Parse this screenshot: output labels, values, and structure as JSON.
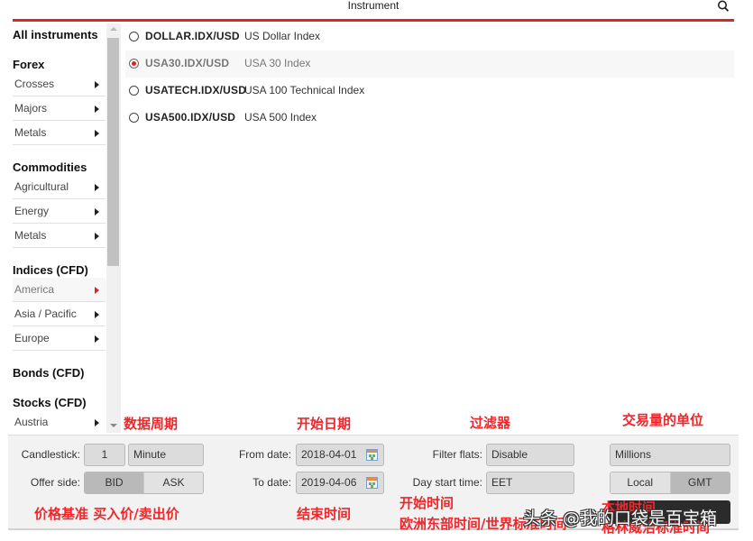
{
  "header": {
    "title": "Instrument",
    "search_icon": "magnifier",
    "accent_color": "#d9262c"
  },
  "sidebar": {
    "all_label": "All instruments",
    "groups": [
      {
        "heading": "Forex",
        "items": [
          "Crosses",
          "Majors",
          "Metals"
        ]
      },
      {
        "heading": "Commodities",
        "items": [
          "Agricultural",
          "Energy",
          "Metals"
        ]
      },
      {
        "heading": "Indices (CFD)",
        "items": [
          "America",
          "Asia / Pacific",
          "Europe"
        ],
        "selected": "America"
      },
      {
        "heading": "Bonds (CFD)",
        "items": []
      },
      {
        "heading": "Stocks (CFD)",
        "items": [
          "Austria"
        ]
      }
    ]
  },
  "instruments": [
    {
      "code": "DOLLAR.IDX/USD",
      "name": "US Dollar Index",
      "selected": false
    },
    {
      "code": "USA30.IDX/USD",
      "name": "USA 30 Index",
      "selected": true
    },
    {
      "code": "USATECH.IDX/USD",
      "name": "USA 100 Technical Index",
      "selected": false
    },
    {
      "code": "USA500.IDX/USD",
      "name": "USA 500 Index",
      "selected": false
    }
  ],
  "settings": {
    "candlestick_label": "Candlestick:",
    "candlestick_count": "1",
    "candlestick_unit": "Minute",
    "offer_side_label": "Offer side:",
    "offer_side_options": [
      "BID",
      "ASK"
    ],
    "offer_side_selected": "BID",
    "from_date_label": "From date:",
    "from_date": "2018-04-01",
    "to_date_label": "To date:",
    "to_date": "2019-04-06",
    "filter_flats_label": "Filter flats:",
    "filter_flats": "Disable",
    "day_start_label": "Day start time:",
    "day_start": "EET",
    "volume_unit": "Millions",
    "timezone_options": [
      "Local",
      "GMT"
    ],
    "timezone_selected": "GMT"
  },
  "annotations": {
    "period": "数据周期",
    "start_date": "开始日期",
    "filter": "过滤器",
    "volume_unit": "交易量的单位",
    "price_basis": "价格基准 买入价/卖出价",
    "end_time": "结束时间",
    "start_time": "开始时间",
    "eet_desc": "欧洲东部时间/世界标准时间",
    "local_time": "本地时间",
    "gmt_desc": "格林威治标准时间"
  },
  "watermark": "头条 @我的口袋是百宝箱"
}
